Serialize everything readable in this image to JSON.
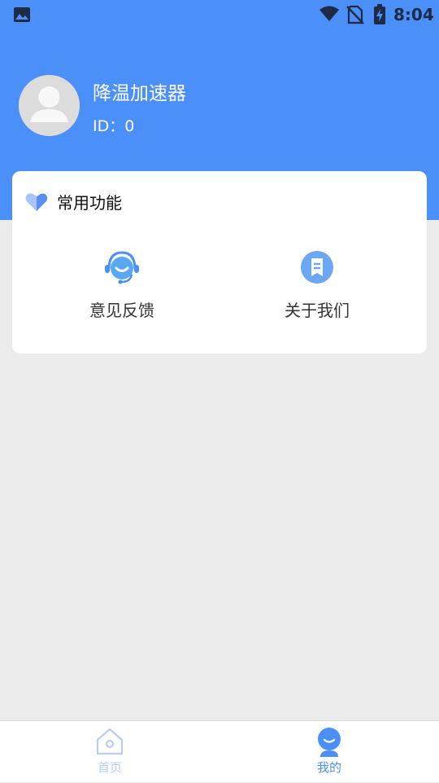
{
  "status_bar": {
    "time": "8:04",
    "icons": [
      "photo-icon",
      "wifi-icon",
      "no-sim-icon",
      "battery-charging-icon"
    ]
  },
  "profile": {
    "name": "降温加速器",
    "id_text": "ID：0",
    "avatar_icon": "avatar-placeholder-icon"
  },
  "common_functions": {
    "title": "常用功能",
    "title_icon": "heart-icon",
    "items": [
      {
        "label": "意见反馈",
        "icon": "feedback-headset-icon"
      },
      {
        "label": "关于我们",
        "icon": "about-document-icon"
      }
    ]
  },
  "tab_bar": {
    "tabs": [
      {
        "label": "首页",
        "icon": "home-icon",
        "active": false
      },
      {
        "label": "我的",
        "icon": "profile-face-icon",
        "active": true
      }
    ]
  },
  "colors": {
    "brand_blue": "#4b8ff9",
    "background": "#ebebeb",
    "tab_active": "#4b8ff9",
    "tab_inactive": "#b9cdee"
  }
}
